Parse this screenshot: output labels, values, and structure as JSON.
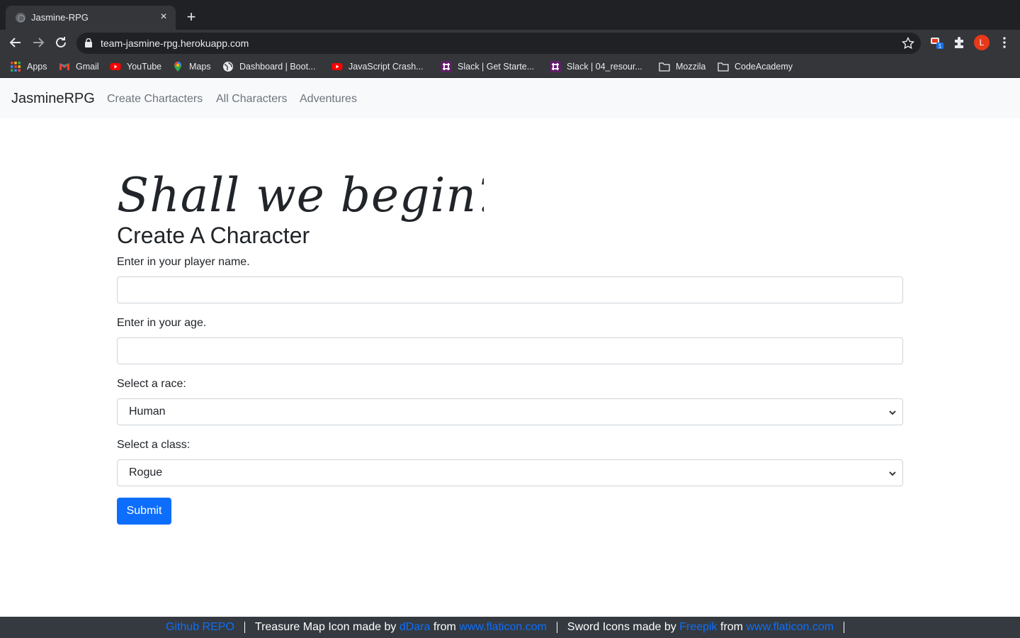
{
  "browser": {
    "tab_title": "Jasmine-RPG",
    "tab_close": "×",
    "new_tab": "+",
    "url": "team-jasmine-rpg.herokuapp.com",
    "profile_initial": "L",
    "extension_badge": "1",
    "bookmarks": [
      {
        "label": "Apps",
        "icon": "apps-grid-icon"
      },
      {
        "label": "Gmail",
        "icon": "gmail-icon"
      },
      {
        "label": "YouTube",
        "icon": "youtube-icon"
      },
      {
        "label": "Maps",
        "icon": "maps-icon"
      },
      {
        "label": "Dashboard | Boot...",
        "icon": "globe-icon"
      },
      {
        "label": "JavaScript Crash...",
        "icon": "youtube-icon"
      },
      {
        "label": "Slack | Get Starte...",
        "icon": "slack-icon"
      },
      {
        "label": "Slack | 04_resour...",
        "icon": "slack-icon"
      },
      {
        "label": "Mozzila",
        "icon": "folder-icon"
      },
      {
        "label": "CodeAcademy",
        "icon": "folder-icon"
      }
    ]
  },
  "navbar": {
    "brand": "JasmineRPG",
    "links": [
      "Create Chartacters",
      "All Characters",
      "Adventures"
    ]
  },
  "main": {
    "script_heading": "Shall we begin?",
    "title": "Create A Character",
    "name_label": "Enter in your player name.",
    "name_value": "",
    "age_label": "Enter in your age.",
    "age_value": "",
    "race_label": "Select a race:",
    "race_selected": "Human",
    "class_label": "Select a class:",
    "class_selected": "Rogue",
    "submit_label": "Submit"
  },
  "footer": {
    "github_link": "Github REPO",
    "map_credit_text": "Treasure Map Icon made by ",
    "map_author": "dDara",
    "from_text": " from ",
    "map_site": "www.flaticon.com",
    "sword_credit_text": "Sword Icons made by ",
    "sword_author": "Freepik",
    "sword_site": "www.flaticon.com"
  },
  "colors": {
    "primary": "#0d6efd",
    "navbar_bg": "#f8f9fa",
    "footer_bg": "#343a40",
    "chrome_dark": "#202124",
    "chrome_toolbar": "#35363a"
  }
}
